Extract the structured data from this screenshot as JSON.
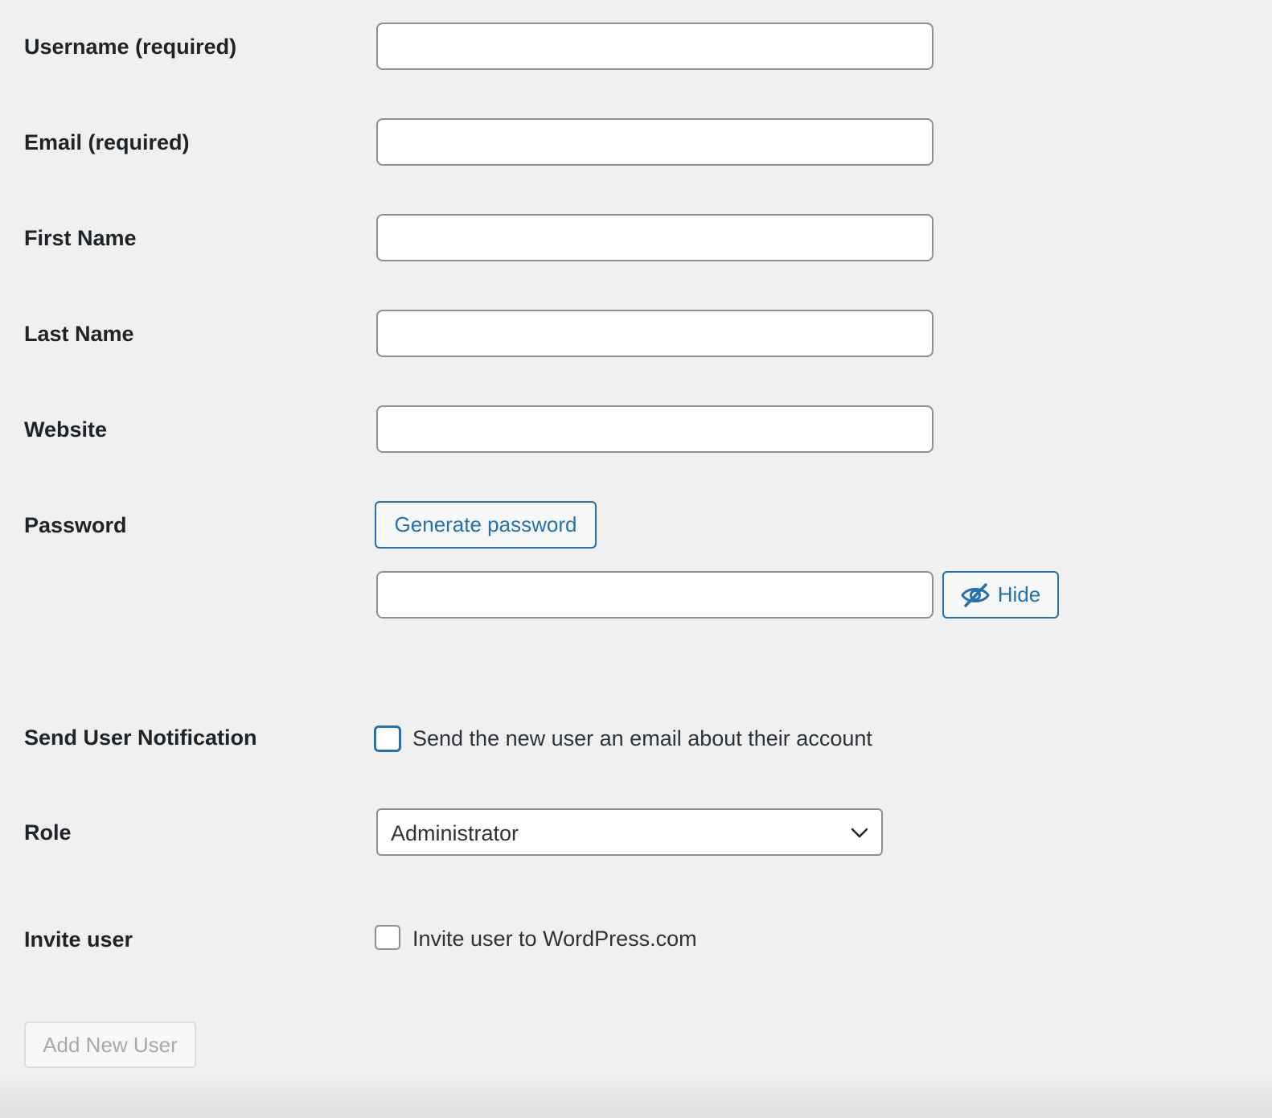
{
  "form": {
    "fields": [
      {
        "label": "Username (required)",
        "value": ""
      },
      {
        "label": "Email (required)",
        "value": ""
      },
      {
        "label": "First Name",
        "value": ""
      },
      {
        "label": "Last Name",
        "value": ""
      },
      {
        "label": "Website",
        "value": ""
      }
    ],
    "password": {
      "label": "Password",
      "generate_button": "Generate password",
      "value": "",
      "hide_button": "Hide",
      "hide_icon": "eye-slash-icon"
    },
    "notification": {
      "label": "Send User Notification",
      "checkbox_label": "Send the new user an email about their account",
      "checked": false
    },
    "role": {
      "label": "Role",
      "selected": "Administrator",
      "icon": "chevron-down-icon"
    },
    "invite": {
      "label": "Invite user",
      "checkbox_label": "Invite user to WordPress.com",
      "checked": false
    },
    "submit_label": "Add New User"
  },
  "colors": {
    "background": "#f0f0f1",
    "accent": "#2271b1",
    "label_text": "#1d2327",
    "input_border": "#8c8f94",
    "disabled_text": "#a7aaad"
  }
}
